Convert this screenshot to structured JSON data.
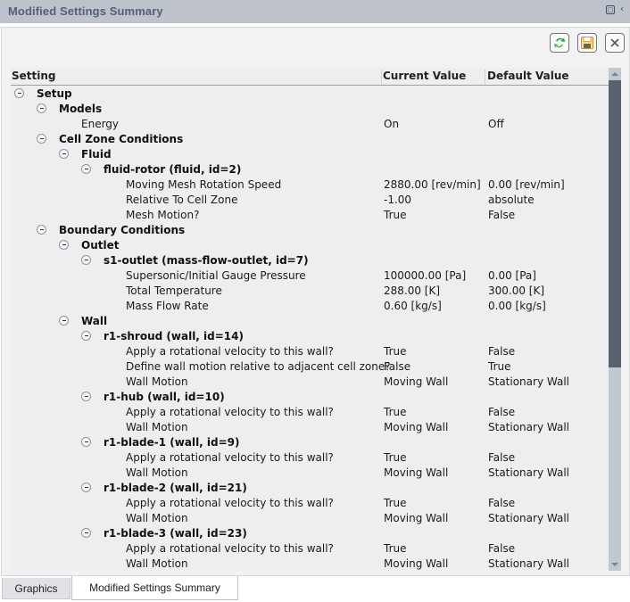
{
  "window": {
    "title": "Modified Settings Summary",
    "title_icons": [
      "restore-icon",
      "collapse-chevron-icon"
    ]
  },
  "toolbar": {
    "buttons": [
      {
        "name": "refresh",
        "icon": "refresh-icon"
      },
      {
        "name": "save",
        "icon": "floppy-disk-icon"
      },
      {
        "name": "close",
        "icon": "close-icon"
      }
    ]
  },
  "table": {
    "headers": {
      "setting": "Setting",
      "current": "Current Value",
      "default": "Default Value"
    },
    "rows": [
      {
        "level": 0,
        "type": "group",
        "label": "Setup"
      },
      {
        "level": 1,
        "type": "group",
        "label": "Models"
      },
      {
        "level": 2,
        "type": "leaf",
        "label": "Energy",
        "current": "On",
        "default": "Off"
      },
      {
        "level": 1,
        "type": "group",
        "label": "Cell Zone Conditions"
      },
      {
        "level": 2,
        "type": "group",
        "label": "Fluid"
      },
      {
        "level": 3,
        "type": "group",
        "label": "fluid-rotor (fluid, id=2)"
      },
      {
        "level": 4,
        "type": "leaf",
        "label": "Moving Mesh Rotation Speed",
        "current": "2880.00 [rev/min]",
        "default": "0.00 [rev/min]"
      },
      {
        "level": 4,
        "type": "leaf",
        "label": "Relative To Cell Zone",
        "current": "-1.00",
        "default": "absolute"
      },
      {
        "level": 4,
        "type": "leaf",
        "label": "Mesh Motion?",
        "current": "True",
        "default": "False"
      },
      {
        "level": 1,
        "type": "group",
        "label": "Boundary Conditions"
      },
      {
        "level": 2,
        "type": "group",
        "label": "Outlet"
      },
      {
        "level": 3,
        "type": "group",
        "label": "s1-outlet (mass-flow-outlet, id=7)"
      },
      {
        "level": 4,
        "type": "leaf",
        "label": "Supersonic/Initial Gauge Pressure",
        "current": "100000.00 [Pa]",
        "default": "0.00 [Pa]"
      },
      {
        "level": 4,
        "type": "leaf",
        "label": "Total Temperature",
        "current": "288.00 [K]",
        "default": "300.00 [K]"
      },
      {
        "level": 4,
        "type": "leaf",
        "label": "Mass Flow Rate",
        "current": "0.60 [kg/s]",
        "default": "0.00 [kg/s]"
      },
      {
        "level": 2,
        "type": "group",
        "label": "Wall"
      },
      {
        "level": 3,
        "type": "group",
        "label": "r1-shroud (wall, id=14)"
      },
      {
        "level": 4,
        "type": "leaf",
        "label": "Apply a rotational velocity to this wall?",
        "current": "True",
        "default": "False"
      },
      {
        "level": 4,
        "type": "leaf",
        "label": "Define wall motion relative to adjacent cell zone?",
        "current": "False",
        "default": "True"
      },
      {
        "level": 4,
        "type": "leaf",
        "label": "Wall Motion",
        "current": "Moving Wall",
        "default": "Stationary Wall"
      },
      {
        "level": 3,
        "type": "group",
        "label": "r1-hub (wall, id=10)"
      },
      {
        "level": 4,
        "type": "leaf",
        "label": "Apply a rotational velocity to this wall?",
        "current": "True",
        "default": "False"
      },
      {
        "level": 4,
        "type": "leaf",
        "label": "Wall Motion",
        "current": "Moving Wall",
        "default": "Stationary Wall"
      },
      {
        "level": 3,
        "type": "group",
        "label": "r1-blade-1 (wall, id=9)"
      },
      {
        "level": 4,
        "type": "leaf",
        "label": "Apply a rotational velocity to this wall?",
        "current": "True",
        "default": "False"
      },
      {
        "level": 4,
        "type": "leaf",
        "label": "Wall Motion",
        "current": "Moving Wall",
        "default": "Stationary Wall"
      },
      {
        "level": 3,
        "type": "group",
        "label": "r1-blade-2 (wall, id=21)"
      },
      {
        "level": 4,
        "type": "leaf",
        "label": "Apply a rotational velocity to this wall?",
        "current": "True",
        "default": "False"
      },
      {
        "level": 4,
        "type": "leaf",
        "label": "Wall Motion",
        "current": "Moving Wall",
        "default": "Stationary Wall"
      },
      {
        "level": 3,
        "type": "group",
        "label": "r1-blade-3 (wall, id=23)"
      },
      {
        "level": 4,
        "type": "leaf",
        "label": "Apply a rotational velocity to this wall?",
        "current": "True",
        "default": "False"
      },
      {
        "level": 4,
        "type": "leaf",
        "label": "Wall Motion",
        "current": "Moving Wall",
        "default": "Stationary Wall"
      }
    ]
  },
  "scrollbar": {
    "position_fraction": 0.0,
    "visible_fraction": 0.6
  },
  "tabs": [
    {
      "label": "Graphics",
      "active": false
    },
    {
      "label": "Modified Settings Summary",
      "active": true
    }
  ],
  "colors": {
    "title_bar": "#bec3cb",
    "title_text": "#546073",
    "scroll_thumb": "#586170",
    "refresh_green": "#3aa33a",
    "save_gold": "#d9a441"
  }
}
